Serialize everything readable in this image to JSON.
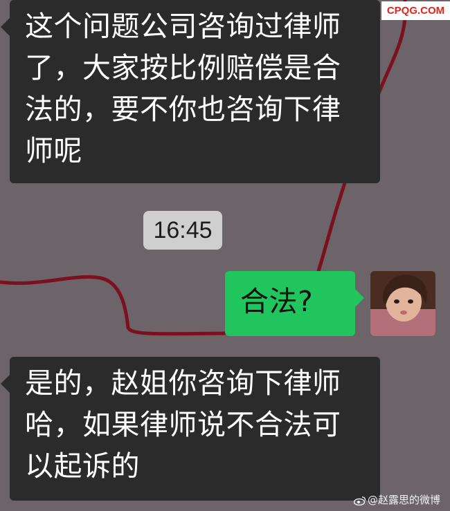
{
  "conversation": {
    "messages": [
      {
        "direction": "incoming",
        "text": "这个问题公司咨询过律师了，大家按比例赔偿是合法的，要不你也咨询下律师呢"
      },
      {
        "direction": "outgoing",
        "text": "合法?"
      },
      {
        "direction": "incoming",
        "text": "是的，赵姐你咨询下律师哈，如果律师说不合法可以起诉的"
      }
    ],
    "timestamp": "16:45"
  },
  "watermarks": {
    "top_right": "CPQG.COM",
    "bottom_right": "@赵露思的微博"
  },
  "colors": {
    "background": "#6c6468",
    "incoming_bubble": "#2b2b2b",
    "outgoing_bubble": "#21c55d",
    "timestamp_pill": "#cfcfcf",
    "drawn_line": "#7a1020",
    "watermark_red": "#e2231a"
  },
  "icons": {
    "weibo": "weibo-icon",
    "avatar": "user-avatar"
  }
}
